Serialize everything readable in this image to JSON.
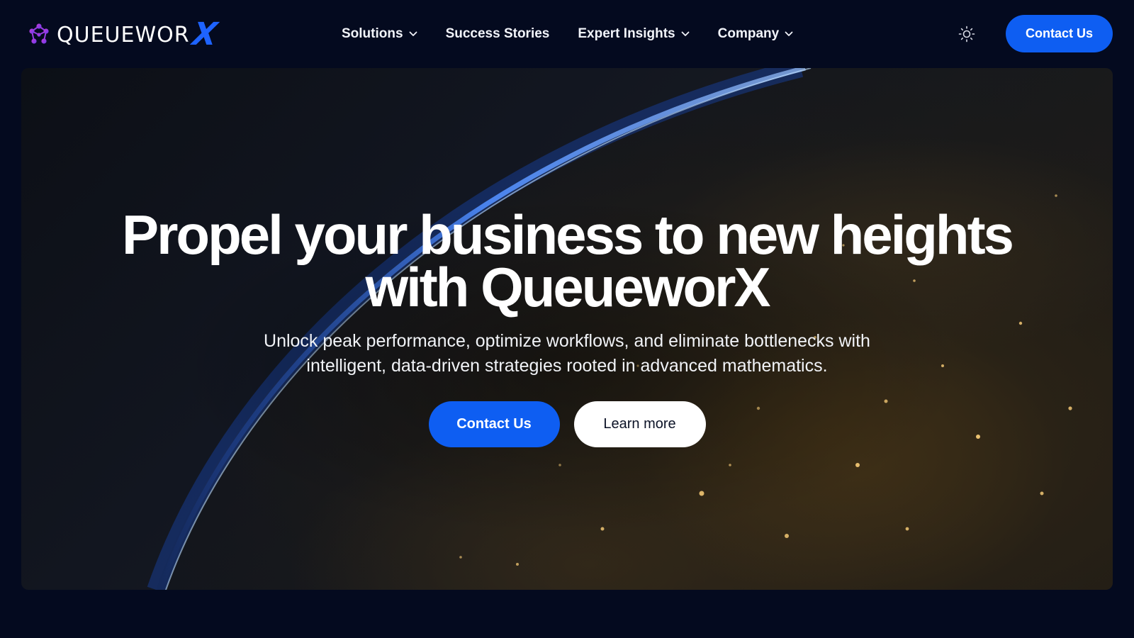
{
  "brand": {
    "name": "QUEUEWOR",
    "name_accent": "X",
    "accent_color": "#1e63ff",
    "logo_icon": "molecule-network-icon"
  },
  "nav": {
    "items": [
      {
        "label": "Solutions",
        "has_dropdown": true
      },
      {
        "label": "Success Stories",
        "has_dropdown": false
      },
      {
        "label": "Expert Insights",
        "has_dropdown": true
      },
      {
        "label": "Company",
        "has_dropdown": true
      }
    ]
  },
  "header": {
    "theme_toggle_icon": "sun-icon",
    "contact_label": "Contact Us"
  },
  "hero": {
    "title_line1": "Propel your business to new heights",
    "title_line2": "with QueueworX",
    "subtitle_line1": "Unlock peak performance, optimize workflows, and eliminate bottlenecks with",
    "subtitle_line2": "intelligent, data-driven strategies rooted in advanced mathematics.",
    "primary_cta": "Contact Us",
    "secondary_cta": "Learn more",
    "background_image": "earth-at-night-from-space"
  },
  "colors": {
    "page_bg": "#040a1f",
    "primary_button": "#0e5ef2",
    "secondary_button": "#ffffff"
  }
}
